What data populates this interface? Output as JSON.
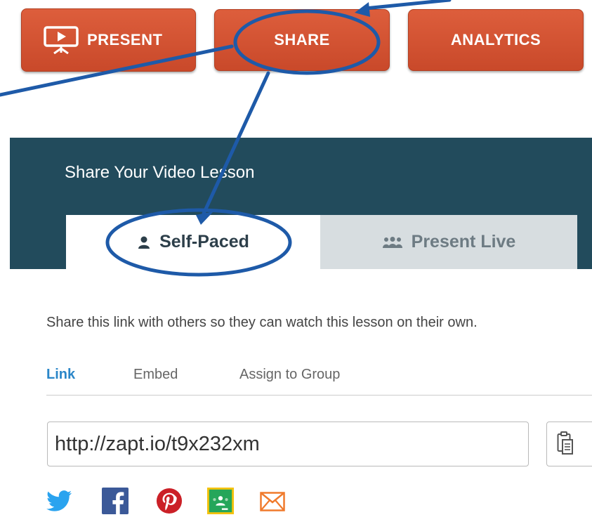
{
  "top_buttons": {
    "present_label": "PRESENT",
    "share_label": "SHARE",
    "analytics_label": "ANALYTICS"
  },
  "share_panel": {
    "title": "Share Your Video Lesson",
    "tabs": [
      {
        "label": "Self-Paced",
        "icon": "person-icon",
        "selected": true
      },
      {
        "label": "Present Live",
        "icon": "group-icon",
        "selected": false
      }
    ]
  },
  "description": "Share this link with others so they can watch this lesson on their own.",
  "subtabs": [
    {
      "label": "Link",
      "selected": true
    },
    {
      "label": "Embed",
      "selected": false
    },
    {
      "label": "Assign to Group",
      "selected": false
    }
  ],
  "link_field": {
    "value": "http://zapt.io/t9x232xm"
  },
  "social_icons": [
    "twitter-icon",
    "facebook-icon",
    "pinterest-icon",
    "google-classroom-icon",
    "email-icon"
  ],
  "colors": {
    "button_orange": "#d3512f",
    "panel_teal": "#224b5c",
    "annotation_blue": "#1e5aa8",
    "link_blue": "#2a86c8"
  }
}
